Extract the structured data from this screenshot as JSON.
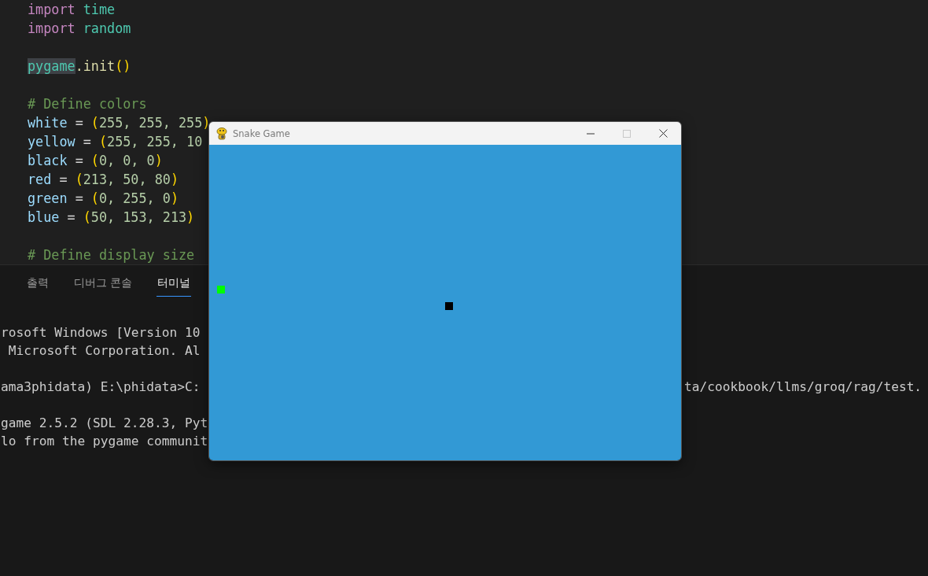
{
  "editor": {
    "lines": [
      {
        "kind": "code",
        "tokens": [
          {
            "text": "import ",
            "kind": "keyword"
          },
          {
            "text": "time",
            "kind": "module"
          }
        ]
      },
      {
        "kind": "code",
        "tokens": [
          {
            "text": "import ",
            "kind": "keyword"
          },
          {
            "text": "random",
            "kind": "module"
          }
        ]
      },
      {
        "kind": "blank"
      },
      {
        "kind": "code",
        "tokens": [
          {
            "text": "pygame",
            "kind": "highlight"
          },
          {
            "text": ".init",
            "kind": "func"
          },
          {
            "text": "()",
            "kind": "bracket"
          }
        ]
      },
      {
        "kind": "blank"
      },
      {
        "kind": "code",
        "tokens": [
          {
            "text": "# Define colors",
            "kind": "comment"
          }
        ]
      },
      {
        "kind": "code",
        "tokens": [
          {
            "text": "white",
            "kind": "variable"
          },
          {
            "text": " = ",
            "kind": "plain"
          },
          {
            "text": "(",
            "kind": "bracket"
          },
          {
            "text": "255, 255, 255",
            "kind": "number"
          },
          {
            "text": ")",
            "kind": "bracket"
          }
        ]
      },
      {
        "kind": "code",
        "tokens": [
          {
            "text": "yellow",
            "kind": "variable"
          },
          {
            "text": " = ",
            "kind": "plain"
          },
          {
            "text": "(",
            "kind": "bracket"
          },
          {
            "text": "255, 255, 10",
            "kind": "number"
          }
        ]
      },
      {
        "kind": "code",
        "tokens": [
          {
            "text": "black",
            "kind": "variable"
          },
          {
            "text": " = ",
            "kind": "plain"
          },
          {
            "text": "(",
            "kind": "bracket"
          },
          {
            "text": "0, 0, 0",
            "kind": "number"
          },
          {
            "text": ")",
            "kind": "bracket"
          }
        ]
      },
      {
        "kind": "code",
        "tokens": [
          {
            "text": "red",
            "kind": "variable"
          },
          {
            "text": " = ",
            "kind": "plain"
          },
          {
            "text": "(",
            "kind": "bracket"
          },
          {
            "text": "213, 50, 80",
            "kind": "number"
          },
          {
            "text": ")",
            "kind": "bracket"
          }
        ]
      },
      {
        "kind": "code",
        "tokens": [
          {
            "text": "green",
            "kind": "variable"
          },
          {
            "text": " = ",
            "kind": "plain"
          },
          {
            "text": "(",
            "kind": "bracket"
          },
          {
            "text": "0, 255, 0",
            "kind": "number"
          },
          {
            "text": ")",
            "kind": "bracket"
          }
        ]
      },
      {
        "kind": "code",
        "tokens": [
          {
            "text": "blue",
            "kind": "variable"
          },
          {
            "text": " = ",
            "kind": "plain"
          },
          {
            "text": "(",
            "kind": "bracket"
          },
          {
            "text": "50, 153, 213",
            "kind": "number"
          },
          {
            "text": ")",
            "kind": "bracket"
          }
        ]
      },
      {
        "kind": "blank"
      },
      {
        "kind": "code",
        "tokens": [
          {
            "text": "# Define display size",
            "kind": "comment"
          }
        ]
      }
    ]
  },
  "panel": {
    "tabs": [
      {
        "label": "출력",
        "selected": false
      },
      {
        "label": "디버그 콘솔",
        "selected": false
      },
      {
        "label": "터미널",
        "selected": true
      }
    ],
    "terminal_lines": [
      {
        "kind": "text",
        "left": "rosoft Windows [Version 10"
      },
      {
        "kind": "text",
        "left": " Microsoft Corporation. Al"
      },
      {
        "kind": "blank"
      },
      {
        "kind": "text",
        "left": "ama3phidata) E:\\phidata>C:",
        "right": "ta/cookbook/llms/groq/rag/test."
      },
      {
        "kind": "blank"
      },
      {
        "kind": "text",
        "left": "game 2.5.2 (SDL 2.28.3, Pyt"
      },
      {
        "kind": "text",
        "left": "lo from the pygame communit"
      }
    ]
  },
  "game_window": {
    "title": "Snake Game"
  }
}
